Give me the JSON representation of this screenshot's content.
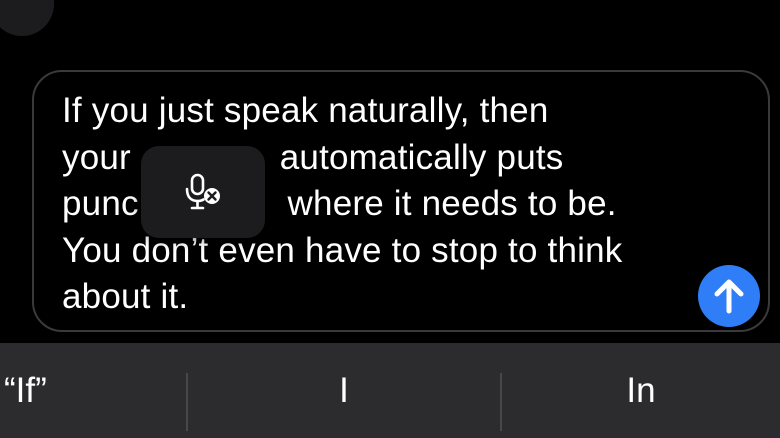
{
  "message": {
    "lines": [
      "If you just speak naturally, then",
      "your               automatically puts",
      "punc               where it needs to be.",
      "You don’t even have to stop to think",
      "about it."
    ]
  },
  "send_button": {
    "icon": "arrow-up-icon",
    "color": "#2f7ef7"
  },
  "dictation": {
    "icon": "microphone-slash-icon"
  },
  "suggestions": [
    {
      "label": "“If”"
    },
    {
      "label": "I"
    },
    {
      "label": "In"
    }
  ],
  "colors": {
    "background": "#000000",
    "field_border": "#3a3a3c",
    "popup": "#1c1c1e",
    "suggestion_bar": "#2c2c2e",
    "text": "#ffffff"
  }
}
